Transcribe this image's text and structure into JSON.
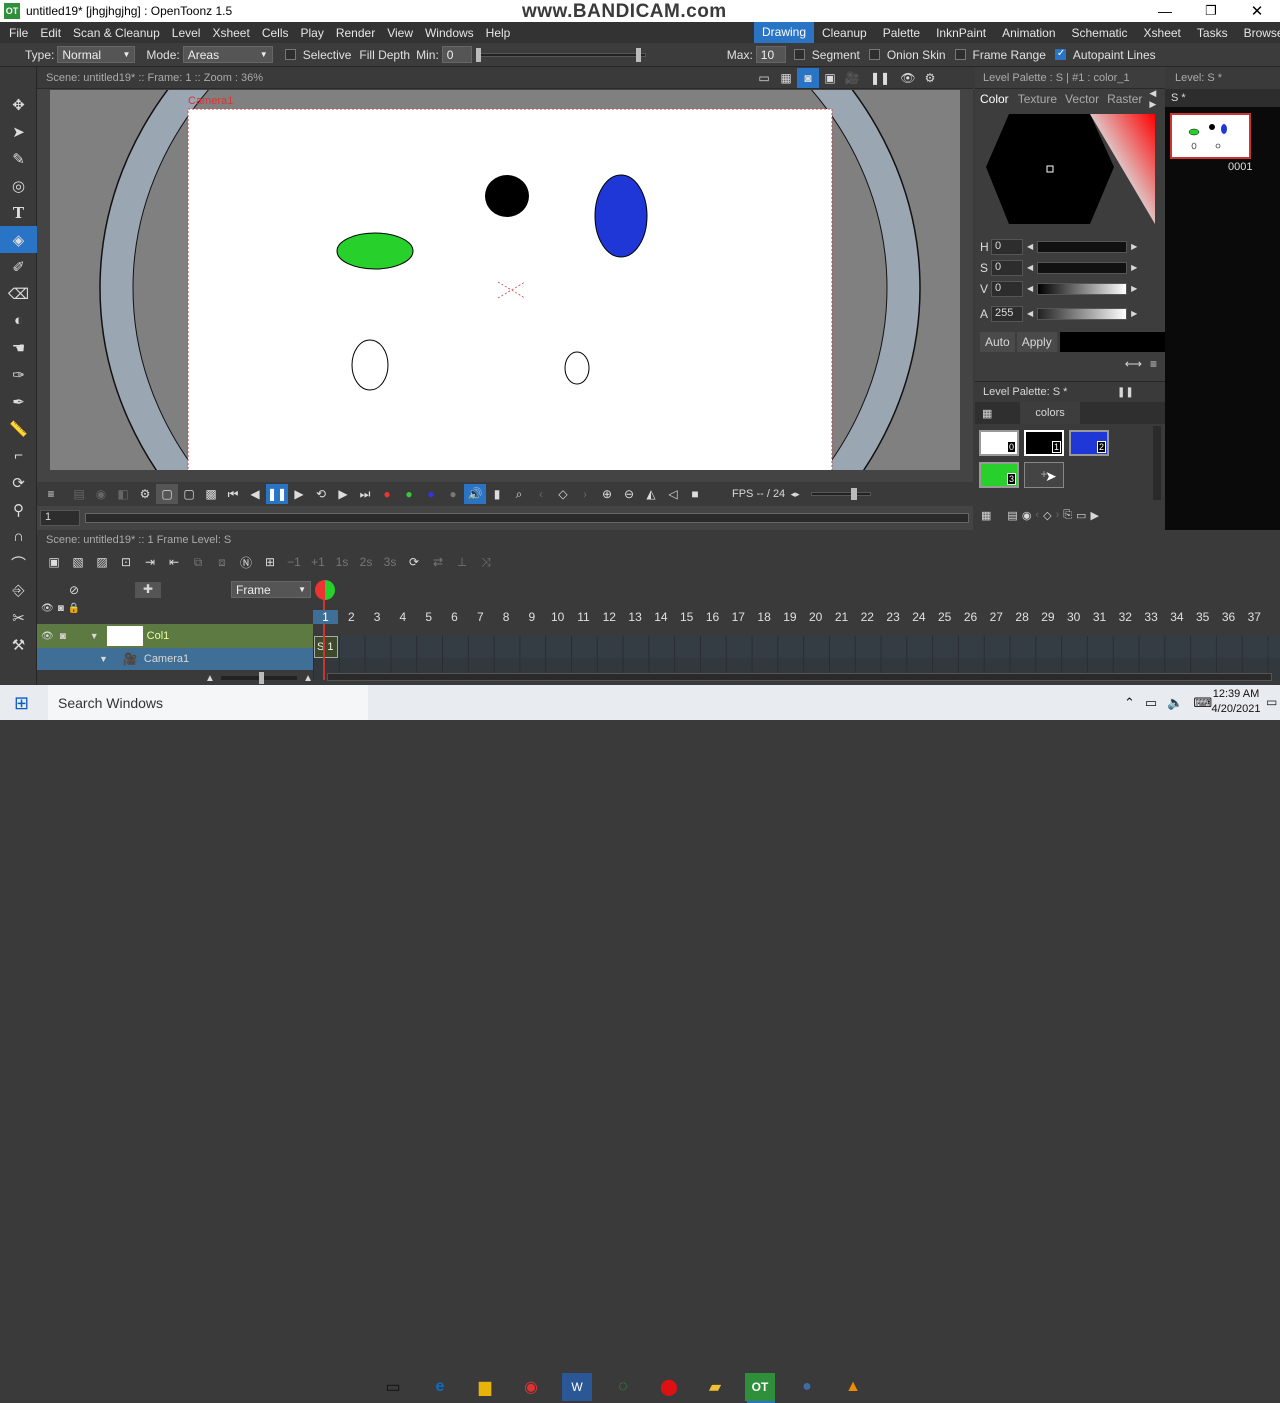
{
  "window": {
    "title": "untitled19* [jhgjhgjhg] : OpenToonz 1.5",
    "app_icon": "OT",
    "watermark": "www.BANDICAM.com"
  },
  "menu": [
    "File",
    "Edit",
    "Scan & Cleanup",
    "Level",
    "Xsheet",
    "Cells",
    "Play",
    "Render",
    "View",
    "Windows",
    "Help"
  ],
  "rooms": [
    "Drawing",
    "Cleanup",
    "Palette",
    "InknPaint",
    "Animation",
    "Schematic",
    "Xsheet",
    "Tasks",
    "Browser"
  ],
  "options": {
    "type_label": "Type:",
    "type_value": "Normal",
    "mode_label": "Mode:",
    "mode_value": "Areas",
    "selective": "Selective",
    "fill_depth": "Fill Depth",
    "min_label": "Min:",
    "min_value": "0",
    "max_label": "Max:",
    "max_value": "10",
    "segment": "Segment",
    "onion_skin": "Onion Skin",
    "frame_range": "Frame Range",
    "autopaint": "Autopaint Lines"
  },
  "viewer": {
    "info": "Scene: untitled19*  ::  Frame: 1  ::  Zoom : 36%",
    "camera_label": "Camera1",
    "fps_label": "FPS -- / 24",
    "frame_field": "1"
  },
  "color_panel": {
    "header": "Level Palette : S | #1 : color_1",
    "tabs": [
      "Color",
      "Texture",
      "Vector",
      "Raster"
    ],
    "h_label": "H",
    "h_value": "0",
    "s_label": "S",
    "s_value": "0",
    "v_label": "V",
    "v_value": "0",
    "a_label": "A",
    "a_value": "255",
    "auto_btn": "Auto",
    "apply_btn": "Apply",
    "palette_title": "Level Palette: S *",
    "palette_page": "colors",
    "chips": [
      {
        "index": "0",
        "color": "#ffffff"
      },
      {
        "index": "1",
        "color": "#000000"
      },
      {
        "index": "2",
        "color": "#1f37d6"
      },
      {
        "index": "3",
        "color": "#27d02b"
      }
    ]
  },
  "level_strip": {
    "header": "Level:  S *",
    "level_name": "S *",
    "frame_label": "0001"
  },
  "xsheet": {
    "info": "Scene: untitled19*  ::  1 Frame  Level: S",
    "frame_combo": "Frame",
    "col1": "Col1",
    "camera_col": "Camera1",
    "cell": "S  1",
    "frames": [
      "1",
      "2",
      "3",
      "4",
      "5",
      "6",
      "7",
      "8",
      "9",
      "10",
      "11",
      "12",
      "13",
      "14",
      "15",
      "16",
      "17",
      "18",
      "19",
      "20",
      "21",
      "22",
      "23",
      "24",
      "25",
      "26",
      "27",
      "28",
      "29",
      "30",
      "31",
      "32",
      "33",
      "34",
      "35",
      "36",
      "37"
    ]
  },
  "taskbar": {
    "search": "Search Windows",
    "time": "12:39 AM",
    "date": "4/20/2021"
  },
  "colors": {
    "accent": "#2a74c5",
    "green": "#27d02b",
    "blue": "#1f37d6",
    "black": "#000000"
  }
}
